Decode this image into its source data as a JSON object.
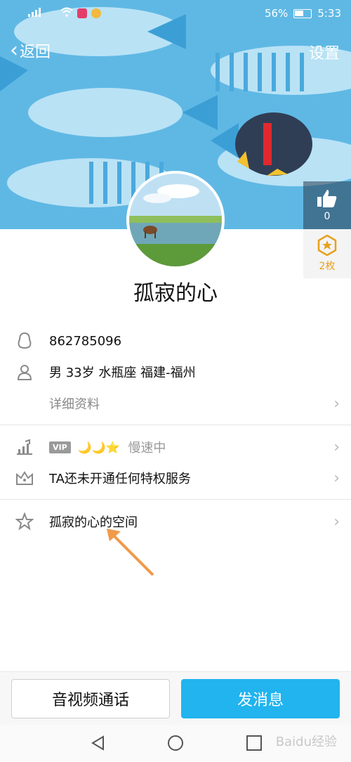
{
  "status_bar": {
    "battery": "56%",
    "time": "5:33"
  },
  "nav": {
    "back_label": "返回",
    "settings_label": "设置"
  },
  "side_panel": {
    "like_count": "0",
    "coin_label": "2枚"
  },
  "profile": {
    "nickname": "孤寂的心"
  },
  "info": {
    "qq_number": "862785096",
    "basic": "男  33岁  水瓶座  福建-福州",
    "detail_label": "详细资料"
  },
  "vip": {
    "badge": "VIP",
    "level_icons": "🌙🌙⭐",
    "status": "慢速中"
  },
  "privilege": {
    "text": "TA还未开通任何特权服务"
  },
  "space": {
    "label": "孤寂的心的空间"
  },
  "actions": {
    "call_label": "音视频通话",
    "message_label": "发消息"
  },
  "watermark": "Baidu经验",
  "colors": {
    "primary_button": "#21b4ef",
    "banner": "#5fb8e4",
    "coin": "#e7a01c"
  }
}
